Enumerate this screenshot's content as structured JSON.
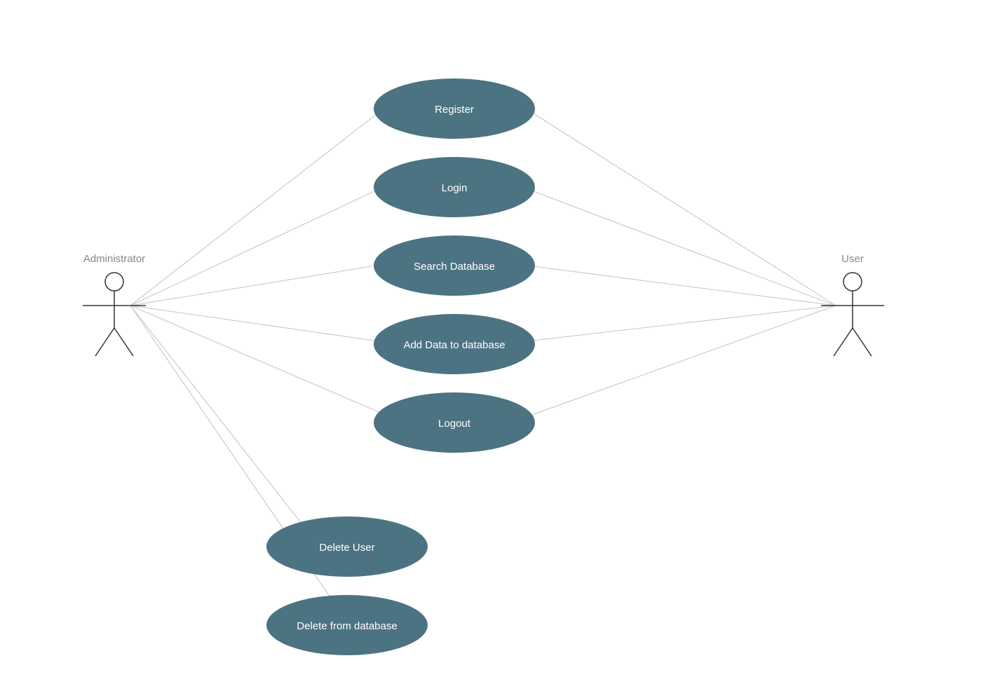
{
  "colors": {
    "usecase_fill": "#4c7382",
    "connector": "#cccccc",
    "actor_stroke": "#333333",
    "label_text": "#ffffff",
    "actor_text": "#888888"
  },
  "actors": {
    "admin": {
      "label": "Administrator"
    },
    "user": {
      "label": "User"
    }
  },
  "usecases": {
    "register": {
      "label": "Register"
    },
    "login": {
      "label": "Login"
    },
    "search_db": {
      "label": "Search Database"
    },
    "add_data": {
      "label": "Add Data to database"
    },
    "logout": {
      "label": "Logout"
    },
    "delete_user": {
      "label": "Delete User"
    },
    "delete_from_db": {
      "label": "Delete  from database"
    }
  }
}
